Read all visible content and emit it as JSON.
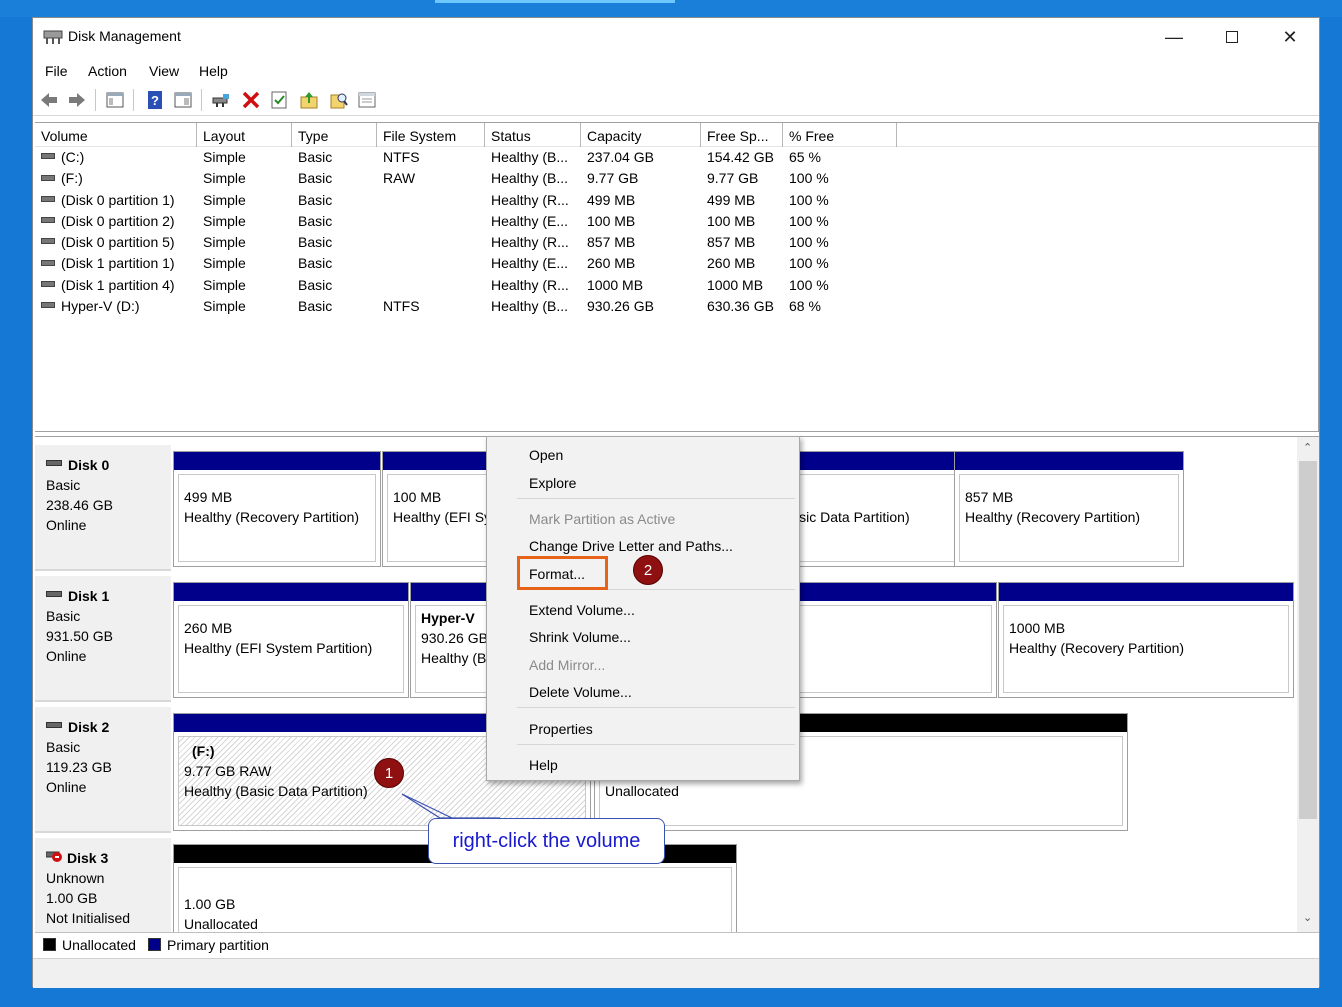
{
  "window": {
    "title": "Disk Management"
  },
  "menu": [
    "File",
    "Action",
    "View",
    "Help"
  ],
  "toolbar": {
    "icons": [
      "back-icon",
      "forward-icon",
      "console-tree-icon",
      "help-icon",
      "properties-icon",
      "connect-icon",
      "delete-icon",
      "checklist-icon",
      "export-icon",
      "search-icon",
      "settings-icon"
    ]
  },
  "list": {
    "columns": [
      "Volume",
      "Layout",
      "Type",
      "File System",
      "Status",
      "Capacity",
      "Free Sp...",
      "% Free"
    ],
    "rows": [
      [
        "(C:)",
        "Simple",
        "Basic",
        "NTFS",
        "Healthy (B...",
        "237.04 GB",
        "154.42 GB",
        "65 %"
      ],
      [
        "(F:)",
        "Simple",
        "Basic",
        "RAW",
        "Healthy (B...",
        "9.77 GB",
        "9.77 GB",
        "100 %"
      ],
      [
        "(Disk 0 partition 1)",
        "Simple",
        "Basic",
        "",
        "Healthy (R...",
        "499 MB",
        "499 MB",
        "100 %"
      ],
      [
        "(Disk 0 partition 2)",
        "Simple",
        "Basic",
        "",
        "Healthy (E...",
        "100 MB",
        "100 MB",
        "100 %"
      ],
      [
        "(Disk 0 partition 5)",
        "Simple",
        "Basic",
        "",
        "Healthy (R...",
        "857 MB",
        "857 MB",
        "100 %"
      ],
      [
        "(Disk 1 partition 1)",
        "Simple",
        "Basic",
        "",
        "Healthy (E...",
        "260 MB",
        "260 MB",
        "100 %"
      ],
      [
        "(Disk 1 partition 4)",
        "Simple",
        "Basic",
        "",
        "Healthy (R...",
        "1000 MB",
        "1000 MB",
        "100 %"
      ],
      [
        "Hyper-V (D:)",
        "Simple",
        "Basic",
        "NTFS",
        "Healthy (B...",
        "930.26 GB",
        "630.36 GB",
        "68 %"
      ]
    ]
  },
  "disks": [
    {
      "name": "Disk 0",
      "type": "Basic",
      "size": "238.46 GB",
      "status": "Online"
    },
    {
      "name": "Disk 1",
      "type": "Basic",
      "size": "931.50 GB",
      "status": "Online"
    },
    {
      "name": "Disk 2",
      "type": "Basic",
      "size": "119.23 GB",
      "status": "Online"
    },
    {
      "name": "Disk 3",
      "type": "Unknown",
      "size": "1.00 GB",
      "status": "Not Initialised"
    }
  ],
  "partitions": {
    "d0p1": {
      "size": "499 MB",
      "status": "Healthy (Recovery Partition)"
    },
    "d0p2": {
      "size": "100 MB",
      "status": "Healthy (EFI Sy"
    },
    "d0p3": {
      "status": "Basic Data Partition)"
    },
    "d0p4": {
      "size": "857 MB",
      "status": "Healthy (Recovery Partition)"
    },
    "d1p1": {
      "size": "260 MB",
      "status": "Healthy (EFI System Partition)"
    },
    "d1p2": {
      "name": "Hyper-V",
      "size": "930.26 GB",
      "status": "Healthy (B"
    },
    "d1p4": {
      "size": "1000 MB",
      "status": "Healthy (Recovery Partition)"
    },
    "d2p1": {
      "name": "(F:)",
      "size": "9.77 GB RAW",
      "status": "Healthy (Basic Data Partition)"
    },
    "d2p2": {
      "status": "Unallocated"
    },
    "d3p1": {
      "size": "1.00 GB",
      "status": "Unallocated"
    }
  },
  "legend": [
    "Unallocated",
    "Primary partition"
  ],
  "legend_colors": {
    "unallocated": "#000000",
    "primary": "#00008b"
  },
  "context_menu": {
    "open": "Open",
    "explore": "Explore",
    "mark_active": "Mark Partition as Active",
    "change_letter": "Change Drive Letter and Paths...",
    "format": "Format...",
    "extend": "Extend Volume...",
    "shrink": "Shrink Volume...",
    "add_mirror": "Add Mirror...",
    "delete": "Delete Volume...",
    "properties": "Properties",
    "help": "Help"
  },
  "annotations": {
    "badge1": "1",
    "badge2": "2",
    "callout": "right-click the volume",
    "highlight_color": "#e8631a"
  }
}
